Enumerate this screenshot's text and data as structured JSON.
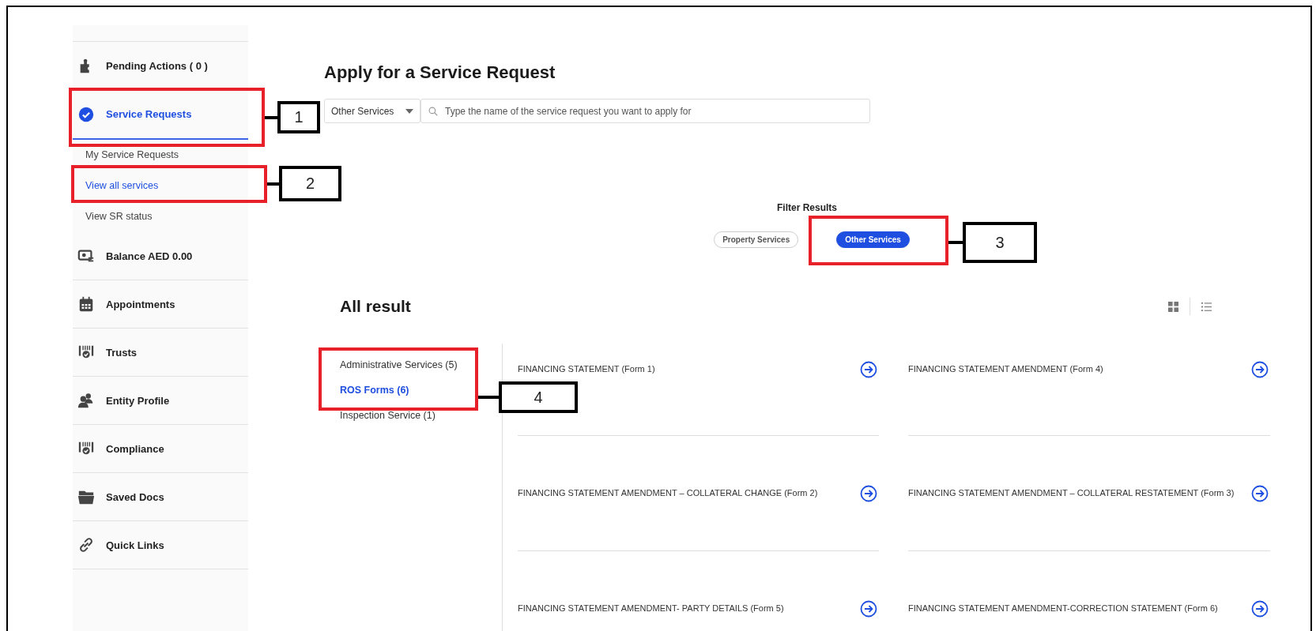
{
  "sidebar": {
    "items": [
      {
        "label": "Pending Actions ( 0 )",
        "selected": false
      },
      {
        "label": "Service Requests",
        "selected": true,
        "children": [
          {
            "label": "My Service Requests",
            "selected": false
          },
          {
            "label": "View all services",
            "selected": true
          },
          {
            "label": "View SR status",
            "selected": false
          }
        ]
      },
      {
        "label": "Balance AED 0.00",
        "selected": false
      },
      {
        "label": "Appointments",
        "selected": false
      },
      {
        "label": "Trusts",
        "selected": false
      },
      {
        "label": "Entity Profile",
        "selected": false
      },
      {
        "label": "Compliance",
        "selected": false
      },
      {
        "label": "Saved Docs",
        "selected": false
      },
      {
        "label": "Quick Links",
        "selected": false
      }
    ]
  },
  "page": {
    "title": "Apply for a Service Request",
    "category_dropdown": {
      "value": "Other Services"
    },
    "search": {
      "placeholder": "Type the name of the service request you want to apply for"
    },
    "filter": {
      "label": "Filter Results",
      "chips": [
        {
          "label": "Property Services",
          "selected": false
        },
        {
          "label": "Other Services",
          "selected": true
        }
      ]
    },
    "results": {
      "title": "All result",
      "categories": [
        {
          "label": "Administrative Services (5)",
          "selected": false
        },
        {
          "label": "ROS Forms (6)",
          "selected": true
        },
        {
          "label": "Inspection Service (1)",
          "selected": false
        }
      ],
      "services": [
        {
          "label": "FINANCING STATEMENT (Form 1)"
        },
        {
          "label": "FINANCING STATEMENT AMENDMENT (Form 4)"
        },
        {
          "label": "FINANCING STATEMENT AMENDMENT – COLLATERAL CHANGE (Form 2)"
        },
        {
          "label": "FINANCING STATEMENT AMENDMENT – COLLATERAL RESTATEMENT (Form 3)"
        },
        {
          "label": "FINANCING STATEMENT AMENDMENT- PARTY DETAILS (Form 5)"
        },
        {
          "label": "FINANCING STATEMENT AMENDMENT-CORRECTION STATEMENT (Form 6)"
        }
      ]
    }
  },
  "annotations": [
    {
      "number": "1"
    },
    {
      "number": "2"
    },
    {
      "number": "3"
    },
    {
      "number": "4"
    }
  ]
}
